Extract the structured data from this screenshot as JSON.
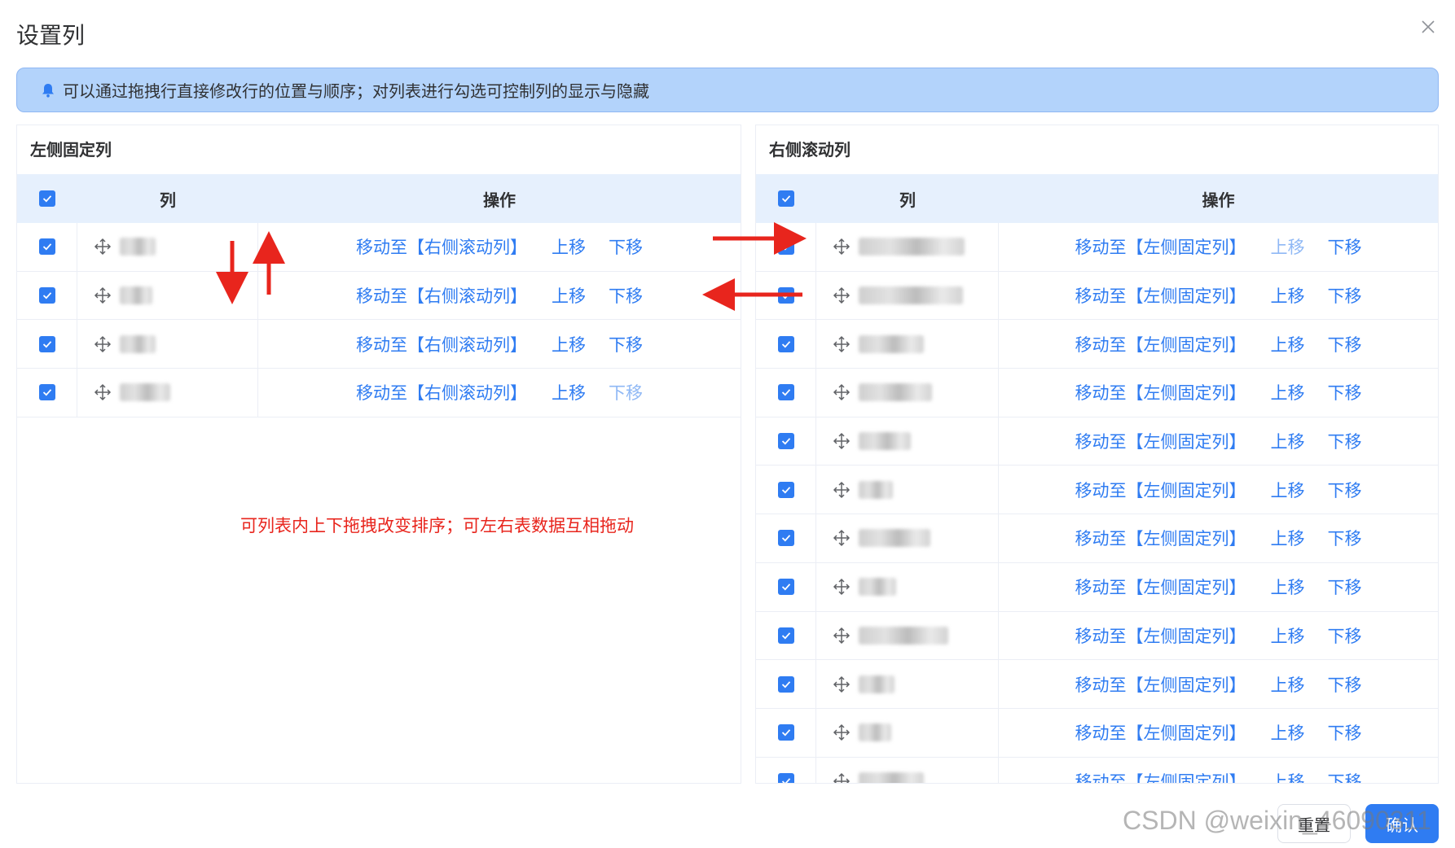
{
  "dialog": {
    "title": "设置列"
  },
  "notice": {
    "text": "可以通过拖拽行直接修改行的位置与顺序；对列表进行勾选可控制列的显示与隐藏"
  },
  "left_panel": {
    "title": "左侧固定列",
    "header": {
      "col": "列",
      "op": "操作"
    },
    "rows": [
      {
        "move_label": "移动至【右侧滚动列】",
        "up": "上移",
        "down": "下移",
        "up_disabled": false,
        "down_disabled": false
      },
      {
        "move_label": "移动至【右侧滚动列】",
        "up": "上移",
        "down": "下移",
        "up_disabled": false,
        "down_disabled": false
      },
      {
        "move_label": "移动至【右侧滚动列】",
        "up": "上移",
        "down": "下移",
        "up_disabled": false,
        "down_disabled": false
      },
      {
        "move_label": "移动至【右侧滚动列】",
        "up": "上移",
        "down": "下移",
        "up_disabled": false,
        "down_disabled": true
      }
    ]
  },
  "right_panel": {
    "title": "右侧滚动列",
    "header": {
      "col": "列",
      "op": "操作"
    },
    "rows": [
      {
        "move_label": "移动至【左侧固定列】",
        "up": "上移",
        "down": "下移",
        "up_disabled": true,
        "down_disabled": false
      },
      {
        "move_label": "移动至【左侧固定列】",
        "up": "上移",
        "down": "下移",
        "up_disabled": false,
        "down_disabled": false
      },
      {
        "move_label": "移动至【左侧固定列】",
        "up": "上移",
        "down": "下移",
        "up_disabled": false,
        "down_disabled": false
      },
      {
        "move_label": "移动至【左侧固定列】",
        "up": "上移",
        "down": "下移",
        "up_disabled": false,
        "down_disabled": false
      },
      {
        "move_label": "移动至【左侧固定列】",
        "up": "上移",
        "down": "下移",
        "up_disabled": false,
        "down_disabled": false
      },
      {
        "move_label": "移动至【左侧固定列】",
        "up": "上移",
        "down": "下移",
        "up_disabled": false,
        "down_disabled": false
      },
      {
        "move_label": "移动至【左侧固定列】",
        "up": "上移",
        "down": "下移",
        "up_disabled": false,
        "down_disabled": false
      },
      {
        "move_label": "移动至【左侧固定列】",
        "up": "上移",
        "down": "下移",
        "up_disabled": false,
        "down_disabled": false
      },
      {
        "move_label": "移动至【左侧固定列】",
        "up": "上移",
        "down": "下移",
        "up_disabled": false,
        "down_disabled": false
      },
      {
        "move_label": "移动至【左侧固定列】",
        "up": "上移",
        "down": "下移",
        "up_disabled": false,
        "down_disabled": false
      },
      {
        "move_label": "移动至【左侧固定列】",
        "up": "上移",
        "down": "下移",
        "up_disabled": false,
        "down_disabled": false
      },
      {
        "move_label": "移动至【左侧固定列】",
        "up": "上移",
        "down": "下移",
        "up_disabled": false,
        "down_disabled": false
      }
    ]
  },
  "annotation": {
    "text": "可列表内上下拖拽改变排序；可左右表数据互相拖动"
  },
  "footer": {
    "reset_label": "重置",
    "ok_label": "确认"
  },
  "watermark": {
    "text": "CSDN @weixin_46090311"
  },
  "colors": {
    "primary": "#2f7cf2",
    "notice_bg": "#b3d3fb",
    "header_bg": "#e6f0fd",
    "annotation": "#e8251d"
  }
}
